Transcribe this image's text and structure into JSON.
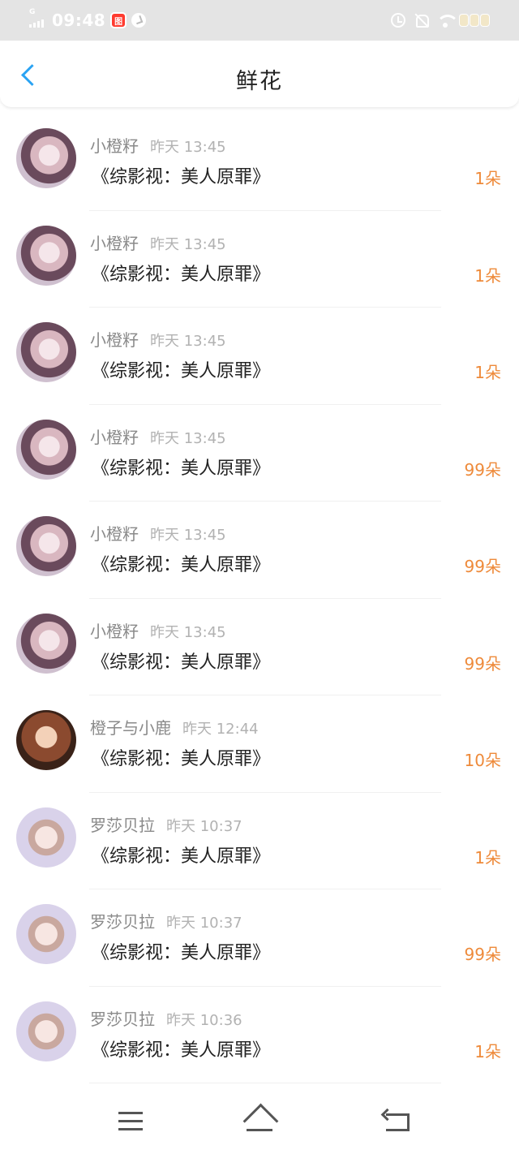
{
  "status_bar": {
    "network": "G",
    "time": "09:48",
    "app_badge": "图"
  },
  "header": {
    "title": "鲜花"
  },
  "list": {
    "items": [
      {
        "name": "小橙籽",
        "time": "昨天 13:45",
        "book": "《综影视：美人原罪》",
        "count": "1朵",
        "avatar": "a1"
      },
      {
        "name": "小橙籽",
        "time": "昨天 13:45",
        "book": "《综影视：美人原罪》",
        "count": "1朵",
        "avatar": "a1"
      },
      {
        "name": "小橙籽",
        "time": "昨天 13:45",
        "book": "《综影视：美人原罪》",
        "count": "1朵",
        "avatar": "a1"
      },
      {
        "name": "小橙籽",
        "time": "昨天 13:45",
        "book": "《综影视：美人原罪》",
        "count": "99朵",
        "avatar": "a1"
      },
      {
        "name": "小橙籽",
        "time": "昨天 13:45",
        "book": "《综影视：美人原罪》",
        "count": "99朵",
        "avatar": "a1"
      },
      {
        "name": "小橙籽",
        "time": "昨天 13:45",
        "book": "《综影视：美人原罪》",
        "count": "99朵",
        "avatar": "a1"
      },
      {
        "name": "橙子与小鹿",
        "time": "昨天 12:44",
        "book": "《综影视：美人原罪》",
        "count": "10朵",
        "avatar": "a2"
      },
      {
        "name": "罗莎贝拉",
        "time": "昨天 10:37",
        "book": "《综影视：美人原罪》",
        "count": "1朵",
        "avatar": "a3"
      },
      {
        "name": "罗莎贝拉",
        "time": "昨天 10:37",
        "book": "《综影视：美人原罪》",
        "count": "99朵",
        "avatar": "a3"
      },
      {
        "name": "罗莎贝拉",
        "time": "昨天 10:36",
        "book": "《综影视：美人原罪》",
        "count": "1朵",
        "avatar": "a3"
      }
    ]
  },
  "colors": {
    "accent_back": "#2aa3f3",
    "count_orange": "#ee8a3a",
    "status_bar_bg": "#e4e4e4"
  },
  "icons": {
    "back": "chevron-left-icon",
    "nav_menu": "menu-icon",
    "nav_home": "home-icon",
    "nav_back": "back-arrow-icon"
  }
}
